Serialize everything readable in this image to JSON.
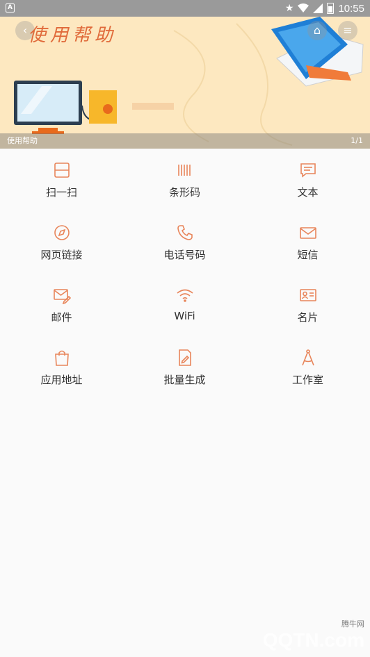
{
  "status_bar": {
    "time": "10:55"
  },
  "banner": {
    "title": "使用帮助",
    "caption": "使用帮助",
    "page_indicator": "1/1"
  },
  "grid": {
    "items": [
      {
        "label": "扫一扫",
        "icon": "scan-icon"
      },
      {
        "label": "条形码",
        "icon": "barcode-icon"
      },
      {
        "label": "文本",
        "icon": "text-message-icon"
      },
      {
        "label": "网页链接",
        "icon": "compass-icon"
      },
      {
        "label": "电话号码",
        "icon": "phone-icon"
      },
      {
        "label": "短信",
        "icon": "envelope-icon"
      },
      {
        "label": "邮件",
        "icon": "mail-edit-icon"
      },
      {
        "label": "WiFi",
        "icon": "wifi-icon"
      },
      {
        "label": "名片",
        "icon": "business-card-icon"
      },
      {
        "label": "应用地址",
        "icon": "shopping-bag-icon"
      },
      {
        "label": "批量生成",
        "icon": "document-edit-icon"
      },
      {
        "label": "工作室",
        "icon": "drafting-compass-icon"
      }
    ],
    "icon_color": "#e8855a"
  },
  "watermark": {
    "text": "QQTN.com",
    "sub": "腾牛网"
  }
}
